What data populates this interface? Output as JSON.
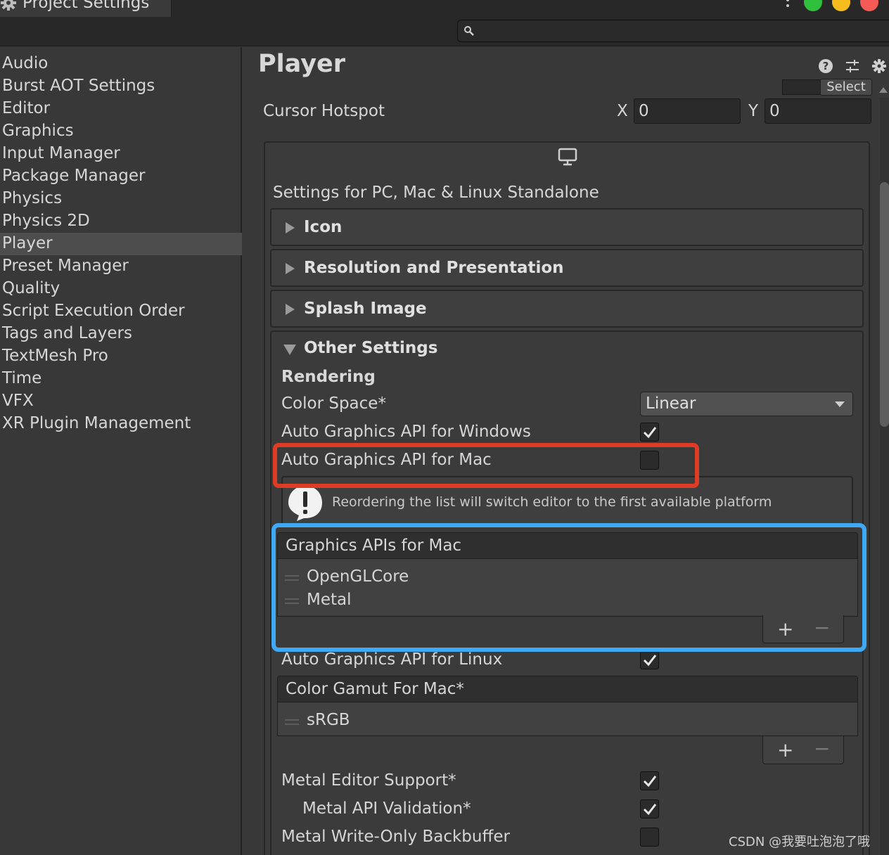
{
  "window": {
    "tab_title": "Project Settings",
    "tab_icon": "gear-icon",
    "menu_icon": "kebab-icon",
    "search": {
      "placeholder": "",
      "icon": "search-icon"
    }
  },
  "sidebar": {
    "items": [
      {
        "label": "Audio",
        "active": false
      },
      {
        "label": "Burst AOT Settings",
        "active": false
      },
      {
        "label": "Editor",
        "active": false
      },
      {
        "label": "Graphics",
        "active": false
      },
      {
        "label": "Input Manager",
        "active": false
      },
      {
        "label": "Package Manager",
        "active": false
      },
      {
        "label": "Physics",
        "active": false
      },
      {
        "label": "Physics 2D",
        "active": false
      },
      {
        "label": "Player",
        "active": true
      },
      {
        "label": "Preset Manager",
        "active": false
      },
      {
        "label": "Quality",
        "active": false
      },
      {
        "label": "Script Execution Order",
        "active": false
      },
      {
        "label": "Tags and Layers",
        "active": false
      },
      {
        "label": "TextMesh Pro",
        "active": false
      },
      {
        "label": "Time",
        "active": false
      },
      {
        "label": "VFX",
        "active": false
      },
      {
        "label": "XR Plugin Management",
        "active": false
      }
    ]
  },
  "main": {
    "title": "Player",
    "header_icons": [
      "help-icon",
      "presets-icon",
      "settings-gear-icon"
    ],
    "select_label": "Select",
    "cursor_hotspot": {
      "label": "Cursor Hotspot",
      "x_label": "X",
      "x_value": "0",
      "y_label": "Y",
      "y_value": "0"
    },
    "platform_icon": "monitor-icon",
    "platform_label": "Settings for PC, Mac & Linux Standalone",
    "foldouts": [
      {
        "label": "Icon",
        "expanded": false
      },
      {
        "label": "Resolution and Presentation",
        "expanded": false
      },
      {
        "label": "Splash Image",
        "expanded": false
      }
    ],
    "other_settings": {
      "title": "Other Settings",
      "expanded": true,
      "rendering_header": "Rendering",
      "color_space": {
        "label": "Color Space*",
        "value": "Linear"
      },
      "auto_windows": {
        "label": "Auto Graphics API  for Windows",
        "checked": true
      },
      "auto_mac": {
        "label": "Auto Graphics API  for Mac",
        "checked": false
      },
      "warning": {
        "icon": "warning-icon",
        "text": "Reordering the list will switch editor to the first available platform"
      },
      "mac_apis": {
        "header": "Graphics APIs for Mac",
        "items": [
          "OpenGLCore",
          "Metal"
        ],
        "add": "+",
        "remove": "−"
      },
      "auto_linux": {
        "label": "Auto Graphics API  for Linux",
        "checked": true
      },
      "color_gamut": {
        "header": "Color Gamut For Mac*",
        "items": [
          "sRGB"
        ],
        "add": "+",
        "remove": "−"
      },
      "metal_editor_support": {
        "label": "Metal Editor Support*",
        "checked": true
      },
      "metal_api_validation": {
        "label": "Metal API Validation*",
        "checked": true
      },
      "metal_write_only": {
        "label": "Metal Write-Only Backbuffer",
        "checked": false
      }
    }
  },
  "colors": {
    "highlight_red": "#e03b25",
    "highlight_blue": "#3fa9f5",
    "traffic_green": "#2fc13d",
    "traffic_yellow": "#f6bd1d",
    "traffic_red": "#f45b57"
  },
  "watermark": "CSDN @我要吐泡泡了哦"
}
